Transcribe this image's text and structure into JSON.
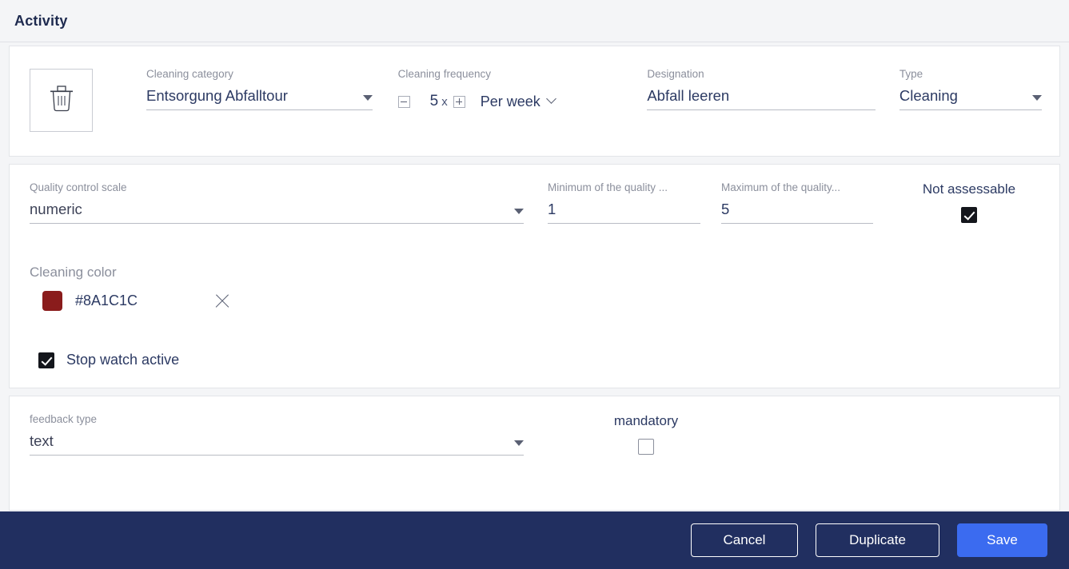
{
  "header": {
    "title": "Activity"
  },
  "identity": {
    "thumbnail_icon": "trash-bin-icon",
    "category": {
      "label": "Cleaning category",
      "value": "Entsorgung Abfalltour"
    },
    "frequency": {
      "label": "Cleaning frequency",
      "count": "5",
      "times_suffix": "x",
      "unit": "Per week",
      "decrement_icon": "minus-icon",
      "increment_icon": "plus-icon"
    },
    "designation": {
      "label": "Designation",
      "value": "Abfall leeren"
    },
    "type": {
      "label": "Type",
      "value": "Cleaning"
    }
  },
  "quality": {
    "scale": {
      "label": "Quality control scale",
      "value": "numeric"
    },
    "minimum": {
      "label": "Minimum of the quality ...",
      "value": "1"
    },
    "maximum": {
      "label": "Maximum of the quality...",
      "value": "5"
    },
    "not_assessable": {
      "label": "Not assessable",
      "checked": true
    },
    "cleaning_color": {
      "label": "Cleaning color",
      "value": "#8A1C1C",
      "swatch_hex": "#8A1C1C",
      "clear_icon": "close-x-icon"
    },
    "stop_watch": {
      "label": "Stop watch active",
      "checked": true
    }
  },
  "feedback": {
    "type": {
      "label": "feedback type",
      "value": "text"
    },
    "mandatory": {
      "label": "mandatory",
      "checked": false
    }
  },
  "footer": {
    "cancel_label": "Cancel",
    "duplicate_label": "Duplicate",
    "save_label": "Save",
    "background": "#212F60",
    "primary_color": "#3B6BF0"
  }
}
